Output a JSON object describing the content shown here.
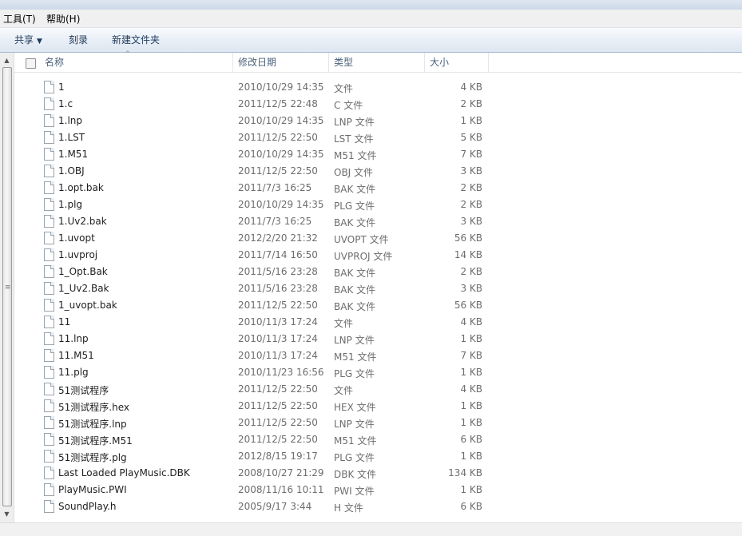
{
  "menubar": {
    "tools": "工具(T)",
    "help": "帮助(H)"
  },
  "toolbar": {
    "share": "共享",
    "burn": "刻录",
    "new_folder": "新建文件夹"
  },
  "columns": {
    "name": "名称",
    "date": "修改日期",
    "type": "类型",
    "size": "大小"
  },
  "files": [
    {
      "name": "1",
      "date": "2010/10/29 14:35",
      "type": "文件",
      "size": "4 KB"
    },
    {
      "name": "1.c",
      "date": "2011/12/5 22:48",
      "type": "C 文件",
      "size": "2 KB"
    },
    {
      "name": "1.lnp",
      "date": "2010/10/29 14:35",
      "type": "LNP 文件",
      "size": "1 KB"
    },
    {
      "name": "1.LST",
      "date": "2011/12/5 22:50",
      "type": "LST 文件",
      "size": "5 KB"
    },
    {
      "name": "1.M51",
      "date": "2010/10/29 14:35",
      "type": "M51 文件",
      "size": "7 KB"
    },
    {
      "name": "1.OBJ",
      "date": "2011/12/5 22:50",
      "type": "OBJ 文件",
      "size": "3 KB"
    },
    {
      "name": "1.opt.bak",
      "date": "2011/7/3 16:25",
      "type": "BAK 文件",
      "size": "2 KB"
    },
    {
      "name": "1.plg",
      "date": "2010/10/29 14:35",
      "type": "PLG 文件",
      "size": "2 KB"
    },
    {
      "name": "1.Uv2.bak",
      "date": "2011/7/3 16:25",
      "type": "BAK 文件",
      "size": "3 KB"
    },
    {
      "name": "1.uvopt",
      "date": "2012/2/20 21:32",
      "type": "UVOPT 文件",
      "size": "56 KB"
    },
    {
      "name": "1.uvproj",
      "date": "2011/7/14 16:50",
      "type": "UVPROJ 文件",
      "size": "14 KB"
    },
    {
      "name": "1_Opt.Bak",
      "date": "2011/5/16 23:28",
      "type": "BAK 文件",
      "size": "2 KB"
    },
    {
      "name": "1_Uv2.Bak",
      "date": "2011/5/16 23:28",
      "type": "BAK 文件",
      "size": "3 KB"
    },
    {
      "name": "1_uvopt.bak",
      "date": "2011/12/5 22:50",
      "type": "BAK 文件",
      "size": "56 KB"
    },
    {
      "name": "11",
      "date": "2010/11/3 17:24",
      "type": "文件",
      "size": "4 KB"
    },
    {
      "name": "11.lnp",
      "date": "2010/11/3 17:24",
      "type": "LNP 文件",
      "size": "1 KB"
    },
    {
      "name": "11.M51",
      "date": "2010/11/3 17:24",
      "type": "M51 文件",
      "size": "7 KB"
    },
    {
      "name": "11.plg",
      "date": "2010/11/23 16:56",
      "type": "PLG 文件",
      "size": "1 KB"
    },
    {
      "name": "51测试程序",
      "date": "2011/12/5 22:50",
      "type": "文件",
      "size": "4 KB"
    },
    {
      "name": "51测试程序.hex",
      "date": "2011/12/5 22:50",
      "type": "HEX 文件",
      "size": "1 KB"
    },
    {
      "name": "51测试程序.lnp",
      "date": "2011/12/5 22:50",
      "type": "LNP 文件",
      "size": "1 KB"
    },
    {
      "name": "51测试程序.M51",
      "date": "2011/12/5 22:50",
      "type": "M51 文件",
      "size": "6 KB"
    },
    {
      "name": "51测试程序.plg",
      "date": "2012/8/15 19:17",
      "type": "PLG 文件",
      "size": "1 KB"
    },
    {
      "name": "Last Loaded PlayMusic.DBK",
      "date": "2008/10/27 21:29",
      "type": "DBK 文件",
      "size": "134 KB"
    },
    {
      "name": "PlayMusic.PWI",
      "date": "2008/11/16 10:11",
      "type": "PWI 文件",
      "size": "1 KB"
    },
    {
      "name": "SoundPlay.h",
      "date": "2005/9/17 3:44",
      "type": "H 文件",
      "size": "6 KB"
    }
  ]
}
